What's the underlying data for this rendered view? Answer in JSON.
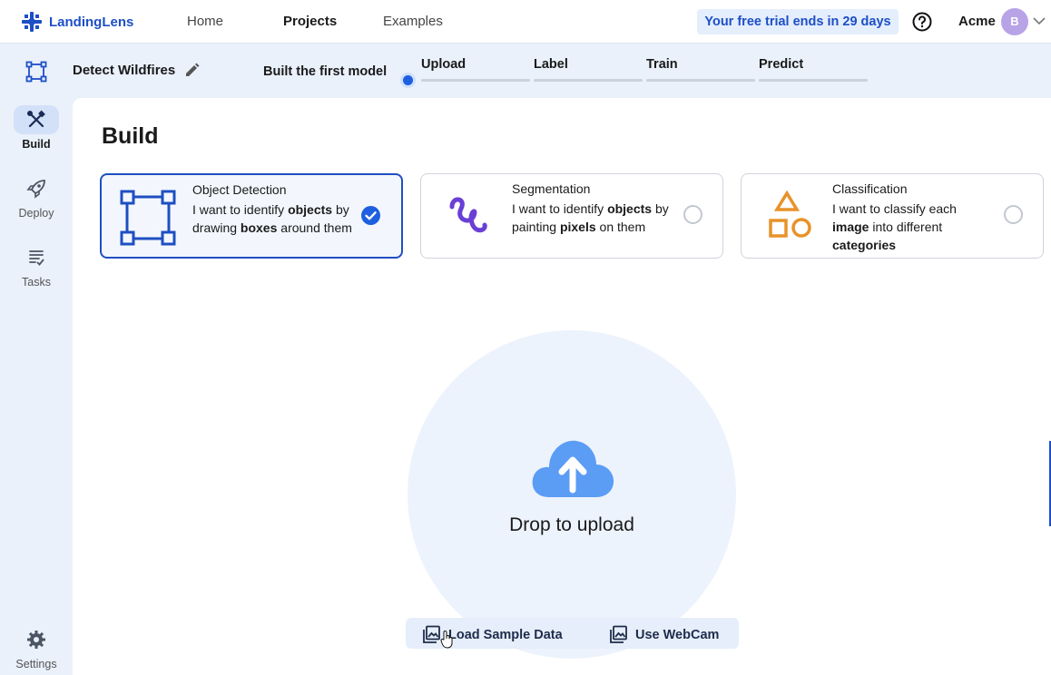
{
  "app": {
    "name": "LandingLens"
  },
  "nav": {
    "home": "Home",
    "projects": "Projects",
    "examples": "Examples"
  },
  "trial_banner": "Your free trial ends in 29 days",
  "org": {
    "name": "Acme",
    "avatar_initial": "B"
  },
  "rail": {
    "build": "Build",
    "deploy": "Deploy",
    "tasks": "Tasks",
    "settings": "Settings"
  },
  "project": {
    "title": "Detect Wildfires",
    "milestone": "Built the first model",
    "steps": [
      "Upload",
      "Label",
      "Train",
      "Predict"
    ]
  },
  "build": {
    "title": "Build",
    "cards": [
      {
        "title": "Object Detection",
        "desc_a": "I want to identify ",
        "bold_1": "objects",
        "desc_b": " by drawing ",
        "bold_2": "boxes",
        "desc_c": " around them",
        "selected": true
      },
      {
        "title": "Segmentation",
        "desc_a": "I want to identify ",
        "bold_1": "objects",
        "desc_b": " by painting ",
        "bold_2": "pixels",
        "desc_c": " on them",
        "selected": false
      },
      {
        "title": "Classification",
        "desc_a": "I want to classify each ",
        "bold_1": "image",
        "desc_b": " into different ",
        "bold_2": "categories",
        "desc_c": "",
        "selected": false
      }
    ]
  },
  "upload": {
    "drop_text": "Drop to upload",
    "load_sample": "Load Sample Data",
    "webcam": "Use WebCam"
  },
  "colors": {
    "accent": "#1e4fc2",
    "dot": "#1e5fe0",
    "cloud": "#5b9cf5",
    "classification": "#e8922a",
    "segmentation": "#6a3fd6"
  }
}
